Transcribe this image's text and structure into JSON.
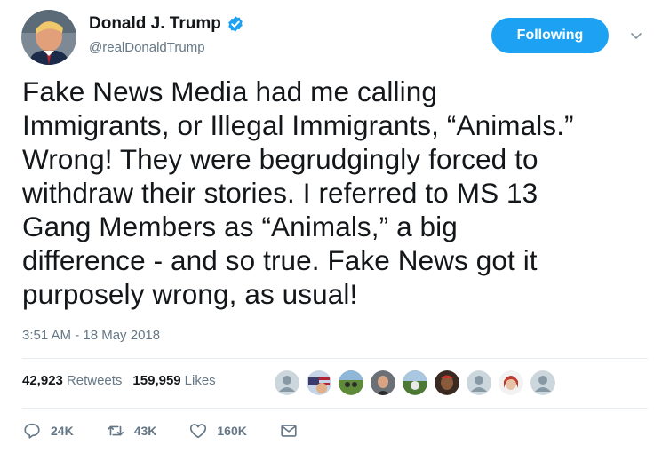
{
  "author": {
    "display_name": "Donald J. Trump",
    "handle": "@realDonaldTrump",
    "verified_icon": "verified-badge-icon",
    "avatar_icon": "avatar"
  },
  "follow_button": {
    "label": "Following"
  },
  "tweet": {
    "lines": [
      "Fake News Media had me calling",
      "Immigrants, or Illegal Immigrants, “Animals.”",
      "Wrong! They were begrudgingly forced to",
      "withdraw their stories. I referred to MS 13",
      "Gang Members as “Animals,” a big",
      "difference - and so true. Fake News got it",
      "purposely wrong, as usual!"
    ],
    "timestamp": "3:51 AM - 18 May 2018"
  },
  "stats": {
    "retweets_count": "42,923",
    "retweets_label": "Retweets",
    "likes_count": "159,959",
    "likes_label": "Likes"
  },
  "actions": {
    "reply_count": "24K",
    "retweet_count": "43K",
    "like_count": "160K"
  },
  "colors": {
    "accent": "#1da1f2",
    "text": "#14171a",
    "secondary": "#657786",
    "divider": "#e6ecf0"
  }
}
